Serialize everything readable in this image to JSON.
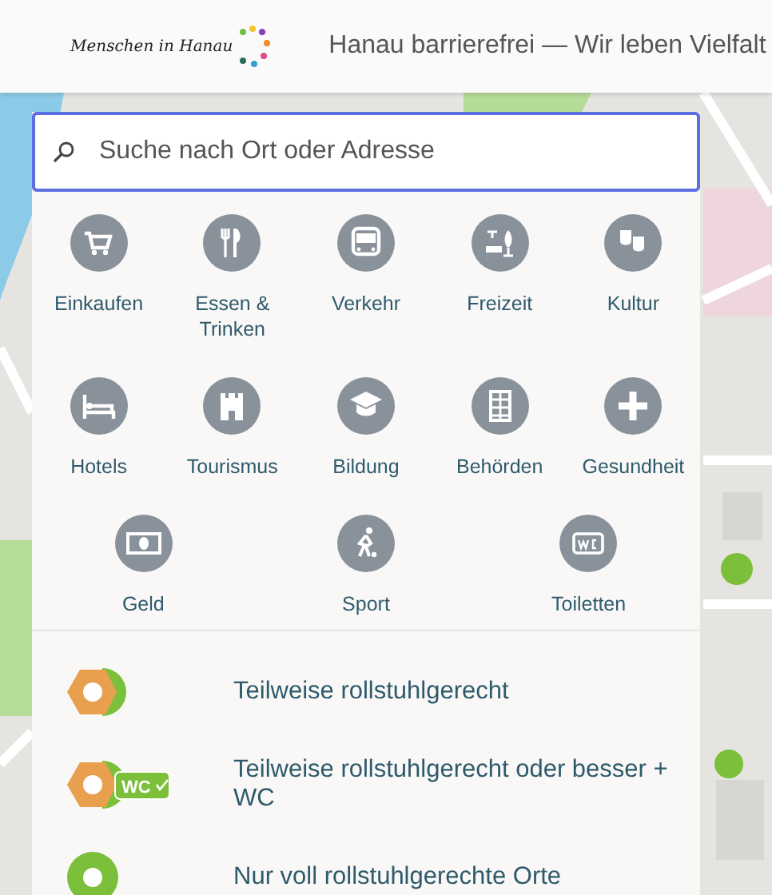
{
  "header": {
    "logo": "Menschen in Hanau",
    "title": "Hanau barrierefrei — Wir leben Vielfalt"
  },
  "search": {
    "placeholder": "Suche nach Ort oder Adresse"
  },
  "category_rows": [
    {
      "items": [
        {
          "label": "Einkaufen"
        },
        {
          "label": "Essen & Trinken"
        },
        {
          "label": "Verkehr"
        },
        {
          "label": "Freizeit"
        },
        {
          "label": "Kultur"
        }
      ]
    },
    {
      "items": [
        {
          "label": "Hotels"
        },
        {
          "label": "Tourismus"
        },
        {
          "label": "Bildung"
        },
        {
          "label": "Behörden"
        },
        {
          "label": "Gesundheit"
        }
      ]
    },
    {
      "items": [
        {
          "label": "Geld"
        },
        {
          "label": "Sport"
        },
        {
          "label": "Toiletten"
        }
      ]
    }
  ],
  "legend": [
    {
      "kind": "partial",
      "label": "Teilweise rollstuhlgerecht"
    },
    {
      "kind": "partial-wc",
      "label": "Teilweise rollstuhlgerecht oder besser + WC",
      "badge": "WC"
    },
    {
      "kind": "full",
      "label": "Nur voll rollstuhlgerechte Orte"
    }
  ]
}
